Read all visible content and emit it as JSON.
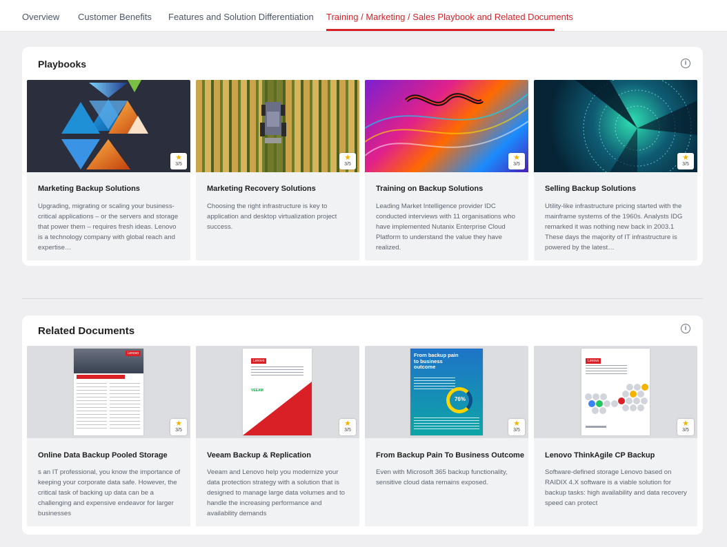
{
  "tabs": [
    {
      "label": "Overview"
    },
    {
      "label": "Customer Benefits"
    },
    {
      "label": "Features and Solution Differentiation"
    },
    {
      "label": "Training / Marketing / Sales Playbook and Related Documents",
      "active": true
    }
  ],
  "playbooks": {
    "title": "Playbooks",
    "cards": [
      {
        "title": "Marketing Backup Solutions",
        "description": "Upgrading, migrating or scaling your business-critical applications – or the servers and storage that power them – requires fresh ideas. Lenovo is a technology company with global reach and expertise…",
        "rating": "3/5"
      },
      {
        "title": "Marketing Recovery Solutions",
        "description": "Choosing the right infrastructure is key to application and desktop virtualization project success.",
        "rating": "3/5"
      },
      {
        "title": "Training on Backup Solutions",
        "description": "Leading Market Intelligence provider IDC conducted interviews with 11 organisations who have implemented Nutanix Enterprise Cloud Platform to understand the value they have realized.",
        "rating": "3/5"
      },
      {
        "title": "Selling Backup Solutions",
        "description": "Utility-like infrastructure pricing started with the mainframe systems of the 1960s. Analysts IDG remarked it was nothing new back in 2003.1 These days the majority of IT infrastructure is powered by the latest…",
        "rating": "3/5"
      }
    ]
  },
  "related": {
    "title": "Related Documents",
    "cards": [
      {
        "title": "Online Data Backup Pooled Storage",
        "description": "s an IT professional, you know the importance of keeping your corporate data safe. However, the critical task of backing up data can be a challenging and expensive endeavor for larger businesses",
        "rating": "3/5"
      },
      {
        "title": "Veeam Backup & Replication",
        "description": "Veeam and Lenovo help you modernize your data protection strategy with a solution that is designed to manage large data volumes and to handle the increasing performance and availability demands",
        "rating": "3/5"
      },
      {
        "title": "From Backup Pain To Business Outcome",
        "description": "Even with Microsoft 365 backup functionality, sensitive cloud data remains exposed.",
        "rating": "3/5"
      },
      {
        "title": "Lenovo ThinkAgile CP Backup",
        "description": "Software-defined storage Lenovo based on RAIDIX 4.X software is a viable solution for backup tasks: high availability and data recovery speed can protect",
        "rating": "3/5"
      }
    ],
    "doc_thumbs": {
      "doc1_brand": "Lenovo",
      "doc2_brand": "Lenovo",
      "doc2_partner": "VEEAM",
      "doc3_heading": "From backup pain to business outcome",
      "doc3_percent": "76%",
      "doc4_brand": "Lenovo"
    }
  },
  "colors": {
    "accent": "#d92027",
    "star": "#f5b301"
  },
  "icons": {
    "info": "info-icon",
    "rating": "star-icon"
  }
}
